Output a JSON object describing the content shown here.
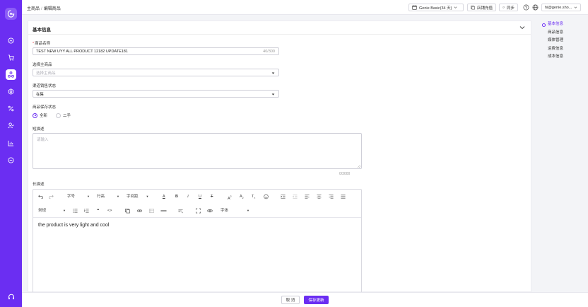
{
  "colors": {
    "brand": "#6b2ef2",
    "required": "#e5484d"
  },
  "rail": {
    "logo": "genie-logo-icon",
    "items": [
      {
        "icon": "dashboard-icon",
        "active": false
      },
      {
        "icon": "cart-icon",
        "active": false
      },
      {
        "icon": "product-icon",
        "active": true
      },
      {
        "icon": "settings-icon",
        "active": false
      },
      {
        "icon": "percent-icon",
        "active": false
      },
      {
        "icon": "users-icon",
        "active": false
      },
      {
        "icon": "chart-icon",
        "active": false
      },
      {
        "icon": "more-icon",
        "active": false
      }
    ],
    "support_icon": "headset-icon"
  },
  "topbar": {
    "breadcrumb": [
      "主商品",
      "编辑商品"
    ],
    "plan": "Genie Basic(34 天)",
    "recharge": "店铺充值",
    "sync": "同步",
    "account": "hi@genie.sho..."
  },
  "card": {
    "title": "基本信息",
    "fields": {
      "name": {
        "label": "商品名称",
        "value": "TEST NEW UYY ALL PRODUCT 12182 UPDATE181",
        "count": "40/300"
      },
      "main_product": {
        "label": "选择主商品",
        "placeholder": "选择主商品"
      },
      "channel_status": {
        "label": "渠道销售状态",
        "value": "在售"
      },
      "condition": {
        "label": "商品保存状态",
        "options": [
          "全新",
          "二手"
        ],
        "selected": "全新"
      },
      "short_desc": {
        "label": "短描述",
        "placeholder": "请输入",
        "count": "0/3000"
      },
      "long_desc": {
        "label": "长描述",
        "toolbar": {
          "font_size": "字号",
          "line_height": "行高",
          "letter_spacing": "字间距",
          "paragraph": "常规",
          "font_family": "字体"
        },
        "content": "the product is very light and cool"
      }
    }
  },
  "anchor_nav": {
    "items": [
      "基本信息",
      "商品信息",
      "媒体管理",
      "运费信息",
      "成本信息"
    ],
    "active": "基本信息"
  },
  "footer": {
    "cancel": "取 消",
    "save": "保存更新"
  }
}
